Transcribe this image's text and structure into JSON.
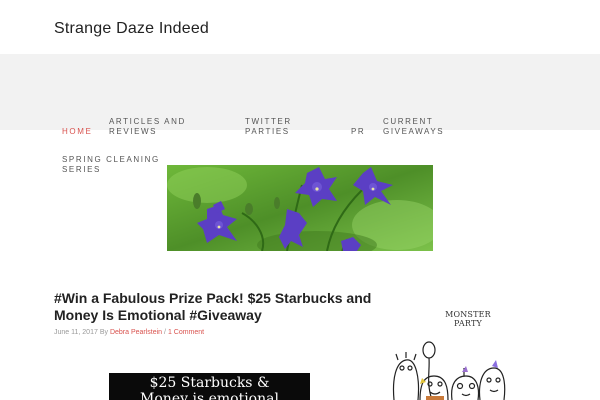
{
  "site": {
    "title": "Strange Daze Indeed"
  },
  "nav": {
    "items": [
      {
        "label": "HOME",
        "active": true
      },
      {
        "label": "ARTICLES AND",
        "label2": "REVIEWS"
      },
      {
        "label": "TWITTER",
        "label2": "PARTIES"
      },
      {
        "label": "PR"
      },
      {
        "label": "CURRENT",
        "label2": "GIVEAWAYS"
      },
      {
        "label": "SPRING CLEANING",
        "label2": "SERIES"
      }
    ]
  },
  "post": {
    "title": "#Win a Fabulous Prize Pack! $25 Starbucks and Money Is Emotional #Giveaway",
    "date": "June 11, 2017",
    "by": "By",
    "author": "Debra Pearlstein",
    "separator": "/",
    "comments": "1 Comment",
    "image_line1": "$25 Starbucks &",
    "image_line2": "Money is emotional"
  },
  "sidebar": {
    "widget_title": "MONSTER PARTY"
  },
  "colors": {
    "accent": "#d9534f",
    "nav_bg": "#f2f2f2",
    "banner_green": "#5a9a2e",
    "flower_purple": "#5b3fc4"
  }
}
